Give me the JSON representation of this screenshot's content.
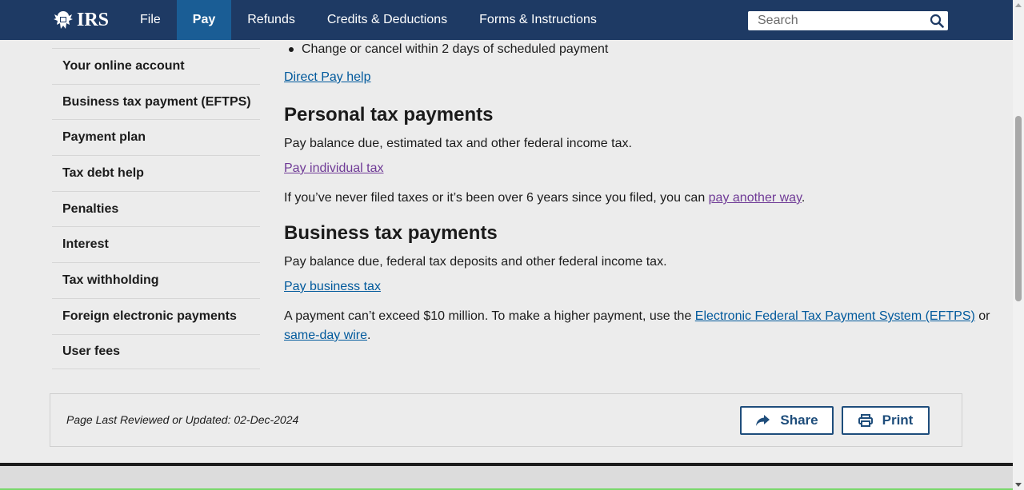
{
  "header": {
    "logo_text": "IRS",
    "nav": [
      {
        "label": "File"
      },
      {
        "label": "Pay"
      },
      {
        "label": "Refunds"
      },
      {
        "label": "Credits & Deductions"
      },
      {
        "label": "Forms & Instructions"
      }
    ],
    "search": {
      "placeholder": "Search",
      "value": ""
    }
  },
  "sidebar": {
    "items": [
      {
        "label": "Your online account"
      },
      {
        "label": "Business tax payment (EFTPS)"
      },
      {
        "label": "Payment plan"
      },
      {
        "label": "Tax debt help"
      },
      {
        "label": "Penalties"
      },
      {
        "label": "Interest"
      },
      {
        "label": "Tax withholding"
      },
      {
        "label": "Foreign electronic payments"
      },
      {
        "label": "User fees"
      }
    ]
  },
  "main": {
    "bullet": "Change or cancel within 2 days of scheduled payment",
    "direct_pay_help": "Direct Pay help",
    "personal": {
      "heading": "Personal tax payments",
      "desc": "Pay balance due, estimated tax and other federal income tax.",
      "link": "Pay individual tax",
      "note_prefix": "If you’ve never filed taxes or it’s been over 6 years since you filed, you can ",
      "note_link": "pay another way",
      "note_suffix": "."
    },
    "business": {
      "heading": "Business tax payments",
      "desc": "Pay balance due, federal tax deposits and other federal income tax.",
      "link": "Pay business tax",
      "note_prefix": "A payment can’t exceed $10 million. To make a higher payment, use the ",
      "note_link1": "Electronic Federal Tax Payment System (EFTPS)",
      "note_mid": " or",
      "note_link2": "same-day wire",
      "note_suffix": "."
    }
  },
  "footer": {
    "reviewed": "Page Last Reviewed or Updated: 02-Dec-2024",
    "share_label": "Share",
    "print_label": "Print"
  },
  "colors": {
    "header_bg": "#1e3a64",
    "nav_active_bg": "#1a5d95",
    "link": "#00599c",
    "visited_link": "#6f3a96",
    "button_border": "#1e4d7b"
  }
}
